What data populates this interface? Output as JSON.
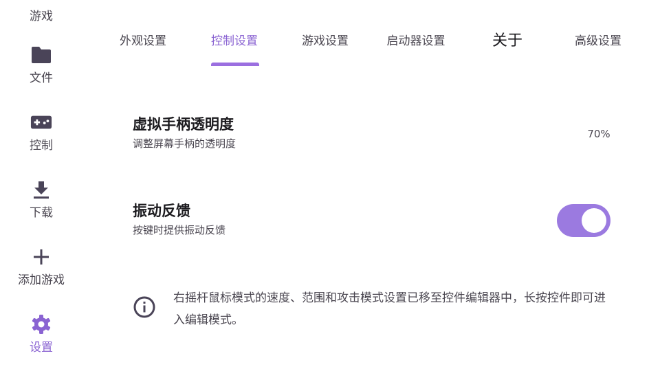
{
  "sidebar": {
    "items": [
      {
        "label": "游戏",
        "icon": "gamepad-icon"
      },
      {
        "label": "文件",
        "icon": "folder-icon"
      },
      {
        "label": "控制",
        "icon": "controller-icon"
      },
      {
        "label": "下载",
        "icon": "download-icon"
      },
      {
        "label": "添加游戏",
        "icon": "plus-icon"
      },
      {
        "label": "设置",
        "icon": "settings-gear-icon"
      }
    ],
    "active_index": 5
  },
  "tabs": [
    {
      "label": "外观设置"
    },
    {
      "label": "控制设置"
    },
    {
      "label": "游戏设置"
    },
    {
      "label": "启动器设置"
    },
    {
      "label": "关于"
    },
    {
      "label": "高级设置"
    }
  ],
  "active_tab": 1,
  "settings": {
    "opacity": {
      "title": "虚拟手柄透明度",
      "subtitle": "调整屏幕手柄的透明度",
      "value": "70%"
    },
    "vibration": {
      "title": "振动反馈",
      "subtitle": "按键时提供振动反馈",
      "enabled": true
    }
  },
  "info": {
    "text": "右摇杆鼠标模式的速度、范围和攻击模式设置已移至控件编辑器中，长按控件即可进入编辑模式。"
  },
  "colors": {
    "accent": "#8a63d2",
    "switch_track": "#9b7ae0",
    "icon_dark": "#4a4458"
  }
}
